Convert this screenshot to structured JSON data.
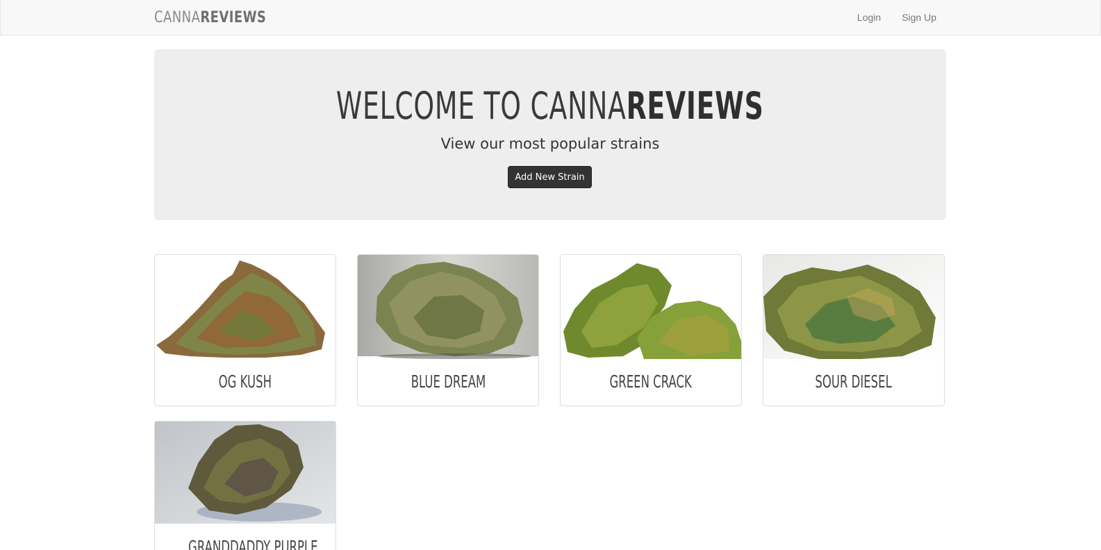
{
  "navbar": {
    "brand_light": "CANNA",
    "brand_bold": "REVIEWS",
    "login_label": "Login",
    "signup_label": "Sign Up"
  },
  "hero": {
    "title_light": "WELCOME TO CANNA",
    "title_bold": "REVIEWS",
    "subtitle": "View our most popular strains",
    "button_label": "Add New Strain"
  },
  "strains": [
    {
      "name": "OG KUSH"
    },
    {
      "name": "BLUE DREAM"
    },
    {
      "name": "GREEN CRACK"
    },
    {
      "name": "SOUR DIESEL"
    },
    {
      "name": "GRANDDADDY PURPLE"
    }
  ],
  "colors": {
    "navbar_bg": "#f8f8f8",
    "jumbotron_bg": "#eeeeee",
    "button_bg": "#333333",
    "text": "#333333"
  }
}
